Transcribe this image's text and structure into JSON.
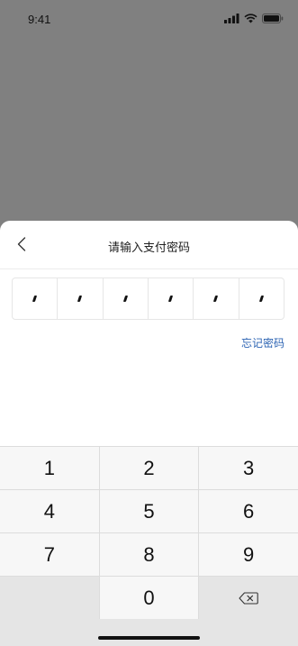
{
  "status": {
    "time": "9:41"
  },
  "sheet": {
    "title": "请输入支付密码",
    "pin_length": 6,
    "forgot_label": "忘记密码"
  },
  "keypad": {
    "rows": [
      [
        "1",
        "2",
        "3"
      ],
      [
        "4",
        "5",
        "6"
      ],
      [
        "7",
        "8",
        "9"
      ],
      [
        "",
        "0",
        "delete"
      ]
    ]
  },
  "icons": {
    "back": "chevron-left-icon",
    "delete": "backspace-icon",
    "signal": "signal-icon",
    "wifi": "wifi-icon",
    "battery": "battery-icon"
  },
  "colors": {
    "overlay": "#808080",
    "link": "#2d64b3",
    "keypad_bg": "#e5e5e5",
    "key_bg": "#f7f7f7"
  }
}
